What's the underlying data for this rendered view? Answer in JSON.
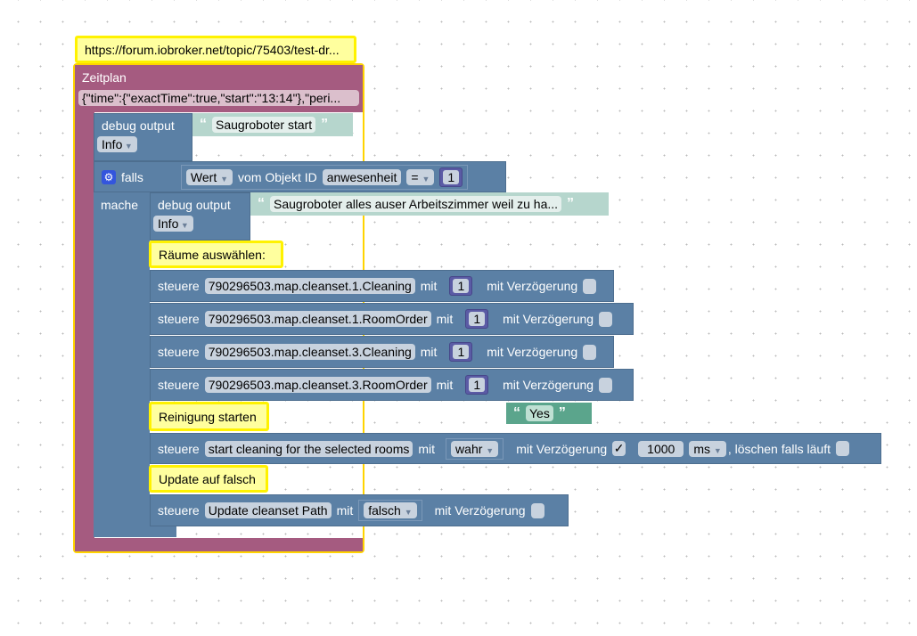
{
  "comment": "https://forum.iobroker.net/topic/75403/test-dr...",
  "schedule": {
    "title": "Zeitplan",
    "value": "{\"time\":{\"exactTime\":true,\"start\":\"13:14\"},\"peri..."
  },
  "debug1": {
    "label": "debug output",
    "text": "Saugroboter start",
    "level": "Info"
  },
  "if_block": {
    "falls": "falls",
    "mache": "mache",
    "field": "Wert",
    "from_obj": "vom Objekt ID",
    "obj": "anwesenheit",
    "op": "=",
    "value": "1"
  },
  "debug2": {
    "label": "debug output",
    "text": "Saugroboter alles auser Arbeitszimmer weil zu ha...",
    "level": "Info"
  },
  "labels": {
    "rooms": "Räume auswählen:",
    "start": "Reinigung starten",
    "update": "Update auf falsch"
  },
  "control": [
    {
      "verb": "steuere",
      "target": "790296503.map.cleanset.1.Cleaning",
      "with": "mit",
      "value": "1",
      "delay": "mit Verzögerung"
    },
    {
      "verb": "steuere",
      "target": "790296503.map.cleanset.1.RoomOrder",
      "with": "mit",
      "value": "1",
      "delay": "mit Verzögerung"
    },
    {
      "verb": "steuere",
      "target": "790296503.map.cleanset.3.Cleaning",
      "with": "mit",
      "value": "1",
      "delay": "mit Verzögerung"
    },
    {
      "verb": "steuere",
      "target": "790296503.map.cleanset.3.RoomOrder",
      "with": "mit",
      "value": "1",
      "delay": "mit Verzögerung"
    }
  ],
  "yes_block": "Yes",
  "start_ctrl": {
    "verb": "steuere",
    "target": "start cleaning for the selected rooms",
    "with": "mit",
    "value": "wahr",
    "delay": "mit Verzögerung",
    "check": "✓",
    "ms": "1000",
    "unit": "ms",
    "clear": ", löschen falls läuft"
  },
  "update_ctrl": {
    "verb": "steuere",
    "target": "Update cleanset Path",
    "with": "mit",
    "value": "falsch",
    "delay": "mit Verzögerung"
  },
  "colors": {
    "schedule": "#a55b80",
    "block": "#5b80a5",
    "highlight": "#fff200",
    "string": "#b6d6cd",
    "text_green": "#5ba58c"
  }
}
